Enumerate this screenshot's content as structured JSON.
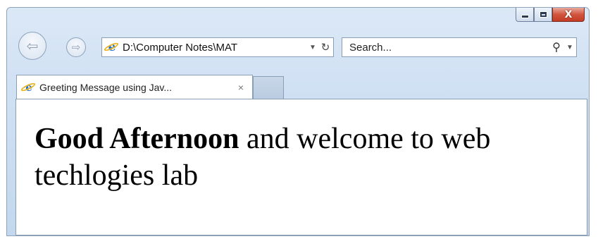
{
  "window": {
    "caption": {
      "minimize_glyph": "minimize-icon",
      "maximize_glyph": "maximize-icon",
      "close_label": "X"
    }
  },
  "nav": {
    "back_icon": "back-arrow-icon",
    "forward_icon": "forward-arrow-icon",
    "address": "D:\\Computer Notes\\MAT",
    "refresh_icon": "refresh-icon",
    "search_placeholder": "Search..."
  },
  "tabs": [
    {
      "title": "Greeting Message using Jav...",
      "close_label": "×"
    }
  ],
  "page": {
    "greeting_bold": "Good Afternoon",
    "greeting_rest": " and welcome to web techlogies lab"
  },
  "colors": {
    "close_button": "#c94a33",
    "frame": "#cfe0f3",
    "ie_blue": "#1b6fd0"
  }
}
